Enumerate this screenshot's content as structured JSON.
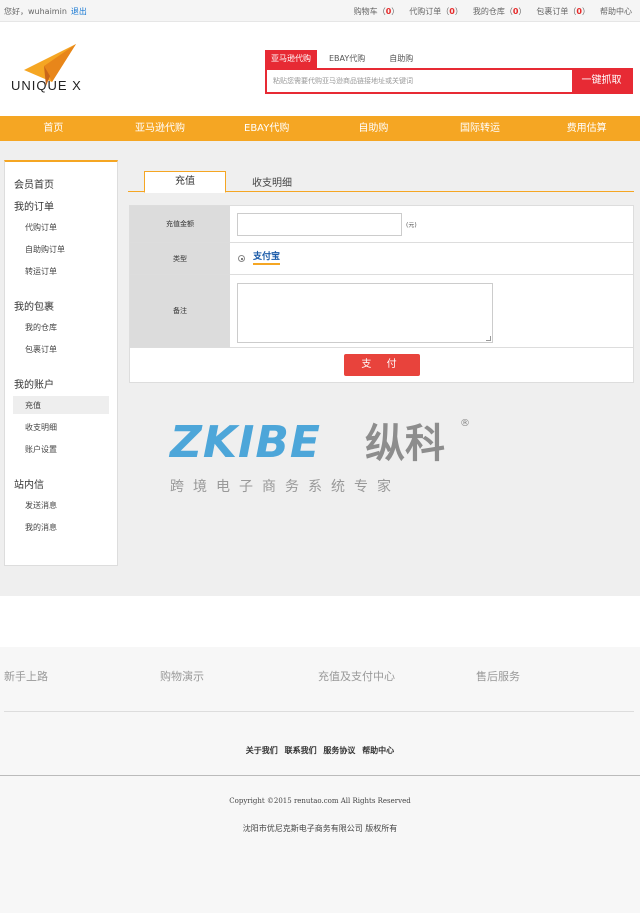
{
  "topbar": {
    "greeting": "您好，wuhaimin",
    "logout": "退出",
    "links": [
      {
        "label": "购物车",
        "count": "0"
      },
      {
        "label": "代购订单",
        "count": "0"
      },
      {
        "label": "我的仓库",
        "count": "0"
      },
      {
        "label": "包裹订单",
        "count": "0"
      },
      {
        "label": "帮助中心",
        "count": ""
      }
    ]
  },
  "header": {
    "logo_text": "UNIQUE X",
    "search_tabs": [
      "亚马逊代购",
      "EBAY代购",
      "自助购"
    ],
    "search_placeholder": "粘贴您需要代购亚马逊商品链接地址或关键词",
    "search_button": "一键抓取"
  },
  "nav": [
    "首页",
    "亚马逊代购",
    "EBAY代购",
    "自助购",
    "国际转运",
    "费用估算"
  ],
  "sidebar": {
    "home": "会员首页",
    "orders": {
      "title": "我的订单",
      "items": [
        "代购订单",
        "自助购订单",
        "转运订单"
      ]
    },
    "packages": {
      "title": "我的包裹",
      "items": [
        "我的仓库",
        "包裹订单"
      ]
    },
    "account": {
      "title": "我的账户",
      "items": [
        "充值",
        "收支明细",
        "账户设置"
      ]
    },
    "messages": {
      "title": "站内信",
      "items": [
        "发送消息",
        "我的消息"
      ]
    }
  },
  "content": {
    "tabs": [
      "充值",
      "收支明细"
    ],
    "form": {
      "amount_label": "充值金额",
      "amount_value": "",
      "unit": "(元)",
      "type_label": "类型",
      "type_option": "支付宝",
      "note_label": "备注",
      "note_value": "",
      "pay_button": "支 付"
    }
  },
  "watermark": {
    "brand": "ZKIBE",
    "cn": "纵科",
    "reg": "®",
    "slogan": "跨境电子商务系统专家"
  },
  "footer": {
    "columns": [
      "新手上路",
      "购物演示",
      "充值及支付中心",
      "售后服务"
    ],
    "links": [
      "关于我们",
      "联系我们",
      "服务协议",
      "帮助中心"
    ],
    "copyright": "Copyright ©2015 renutao.com All Rights Reserved",
    "company": "沈阳市优尼克斯电子商务有限公司 版权所有"
  },
  "colors": {
    "accent": "#f5a623",
    "primary_red": "#e72a34",
    "link_blue": "#1a7ad4",
    "watermark_blue": "#4da6d9"
  }
}
